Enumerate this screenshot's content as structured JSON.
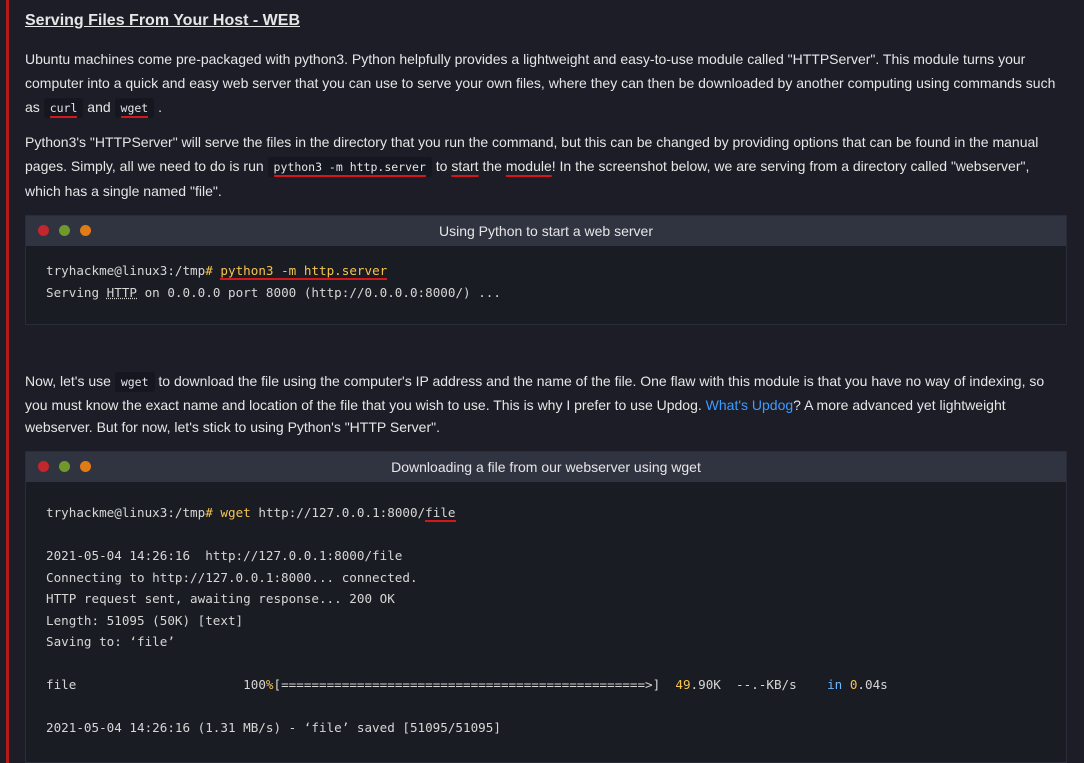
{
  "heading": "Serving Files From Your Host - WEB",
  "para1": {
    "text": "Ubuntu machines come pre-packaged with python3. Python helpfully provides a lightweight and easy-to-use module called \"HTTPServer\". This module turns your computer into a quick and easy web server that you can use to serve your own files, where they can then be downloaded by another computing using commands such as",
    "code1": "curl",
    "and": "and",
    "code2": "wget",
    "end": "."
  },
  "para2": {
    "text1": "Python3's \"HTTPServer\" will serve the files in the directory that you run the command, but this can be changed by providing options that can be found in the manual pages. Simply, all we need to do is run",
    "code": "python3 -m  http.server",
    "to": "to",
    "start": "start",
    "the": "the",
    "module": "module",
    "text2": "! In the screenshot below, we are serving from a directory called \"webserver\", which has a single named \"file\"."
  },
  "terminal1": {
    "title": "Using Python to start a web server",
    "prompt": "tryhackme@linux3:/tmp",
    "hash": "#",
    "command": "python3 -m http.server",
    "output_prefix": "Serving ",
    "output_http": "HTTP",
    "output_rest": " on 0.0.0.0 port 8000 (http://0.0.0.0:8000/) ..."
  },
  "para3": {
    "text1": "Now, let's use",
    "code": "wget",
    "text2": "to download the file using the computer's IP address and the name of the file. One flaw with this module is that you have no way of indexing, so you must know the exact name and location of the file that you wish to use. This is why I prefer to use Updog.",
    "link": "What's Updog",
    "text3": "? A more advanced yet lightweight webserver. But for now, let's stick to using Python's \"HTTP Server\"."
  },
  "terminal2": {
    "title": "Downloading a file from our webserver using wget",
    "prompt": "tryhackme@linux3:/tmp",
    "hash": "#",
    "command": "wget",
    "url_prefix": "http://127.0.0.1:8000/",
    "url_file": "file",
    "line1": "2021-05-04 14:26:16  http://127.0.0.1:8000/file",
    "line2": "Connecting to http://127.0.0.1:8000... connected.",
    "line3": "HTTP request sent, awaiting response... 200 OK",
    "line4": "Length: 51095 (50K) [text]",
    "line5": "Saving to: ‘file’",
    "progress_name": "file",
    "progress_pct": "100",
    "progress_pct_sign": "%",
    "progress_bar": "[================================================>]",
    "progress_size_num": "49",
    "progress_size_rest": ".90K",
    "progress_speed": "--.-KB/s",
    "progress_in": "in",
    "progress_time_num": "0",
    "progress_time_rest": ".04s",
    "line_final": "2021-05-04 14:26:16 (1.31 MB/s) - ‘file’ saved [51095/51095]"
  }
}
